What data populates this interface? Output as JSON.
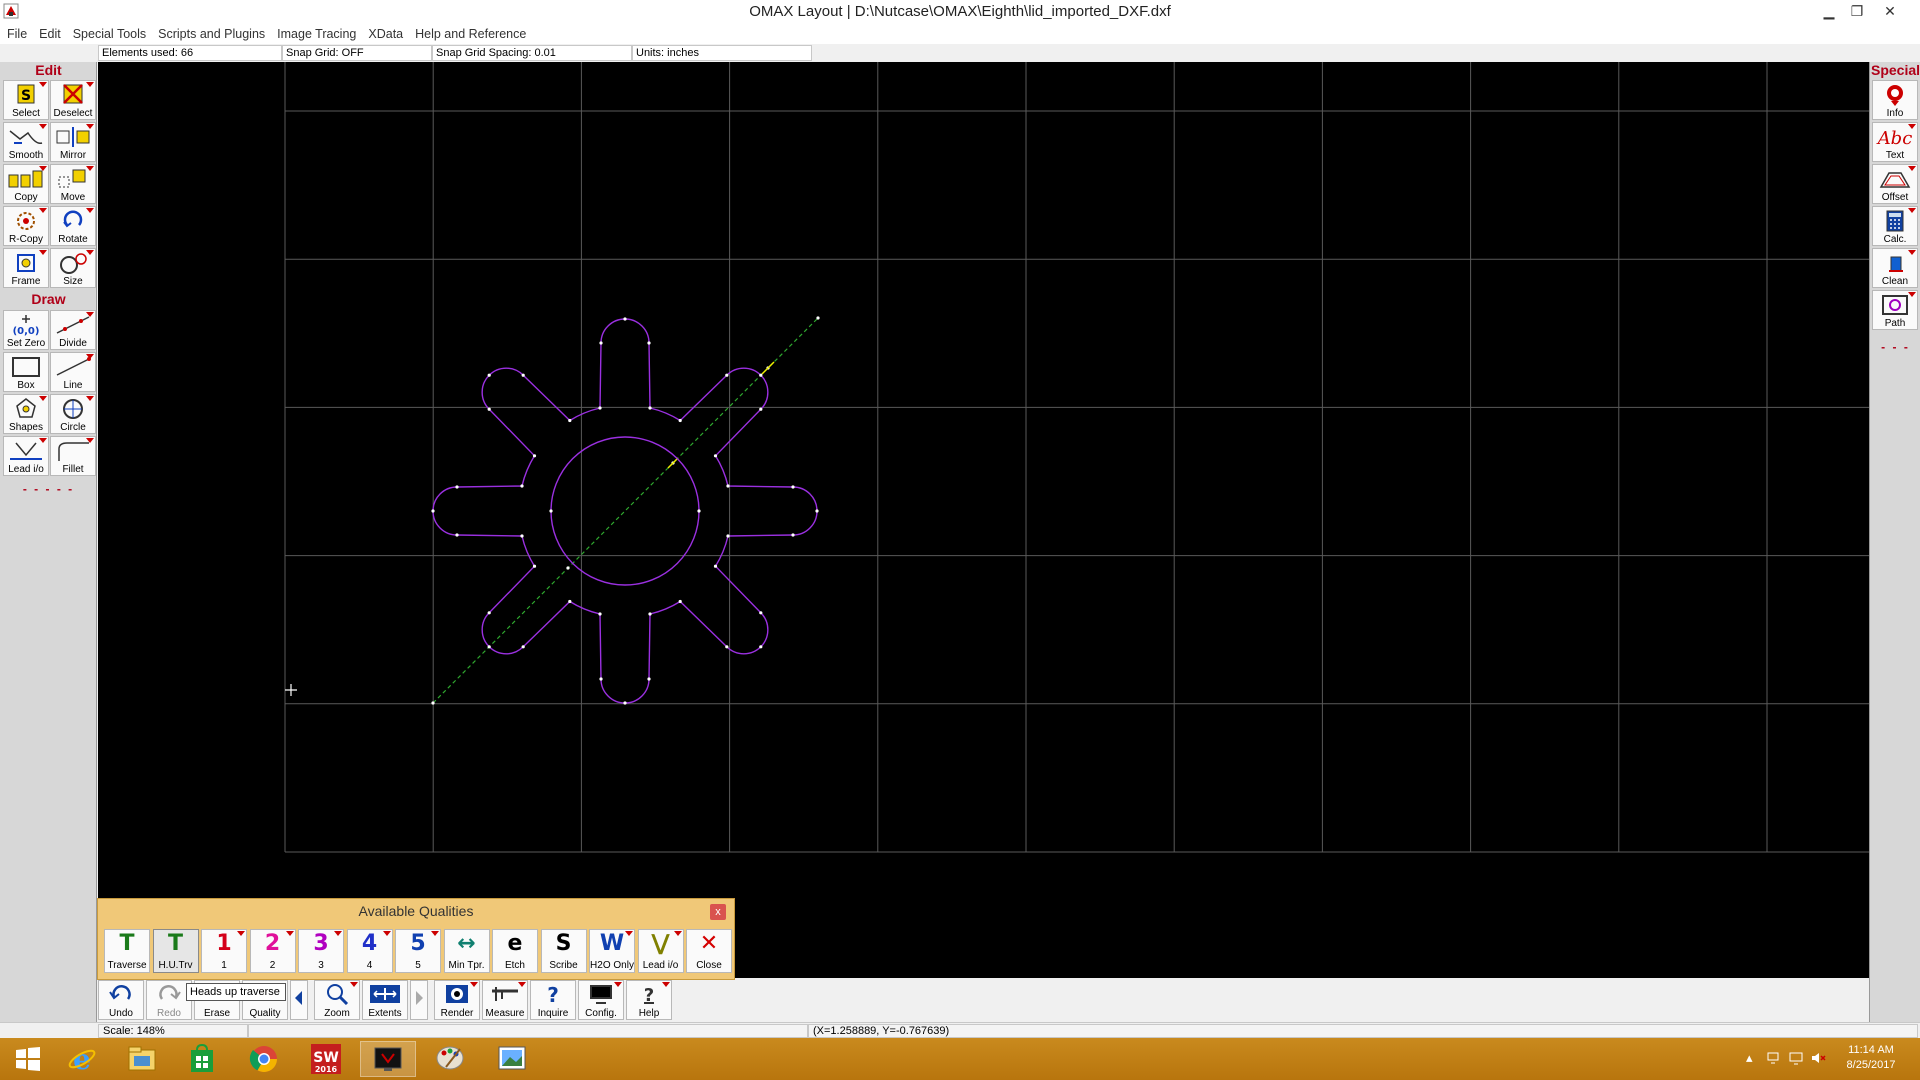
{
  "window": {
    "title": "OMAX Layout | D:\\Nutcase\\OMAX\\Eighth\\lid_imported_DXF.dxf",
    "minimize": "▁",
    "restore": "❐",
    "close": "✕"
  },
  "menu": [
    "File",
    "Edit",
    "Special Tools",
    "Scripts and Plugins",
    "Image Tracing",
    "XData",
    "Help and Reference"
  ],
  "status_fields": {
    "elements_used": "Elements used: 66",
    "snap_grid": "Snap Grid: OFF",
    "snap_spacing": "Snap Grid Spacing: 0.01",
    "units": "Units: inches"
  },
  "left_palette": {
    "edit_header": "Edit",
    "draw_header": "Draw",
    "edit_tools": [
      "Select",
      "Deselect",
      "Smooth",
      "Mirror",
      "Copy",
      "Move",
      "R-Copy",
      "Rotate",
      "Frame",
      "Size"
    ],
    "draw_tools": [
      "Set Zero",
      "Divide",
      "Box",
      "Line",
      "Shapes",
      "Circle",
      "Lead i/o",
      "Fillet"
    ],
    "dashes": "- - - - -"
  },
  "right_palette": {
    "header": "Special",
    "tools": [
      "Info",
      "Text",
      "Offset",
      "Calc.",
      "Clean",
      "Path"
    ],
    "dashes": "- - -"
  },
  "qualities_panel": {
    "title": "Available Qualities",
    "close": "x",
    "buttons": [
      {
        "glyph": "T",
        "label": "Traverse",
        "color": "#1a7a1a"
      },
      {
        "glyph": "T",
        "label": "H.U.Trv",
        "color": "#1a7a1a"
      },
      {
        "glyph": "1",
        "label": "1",
        "color": "#d4001a"
      },
      {
        "glyph": "2",
        "label": "2",
        "color": "#e0109a"
      },
      {
        "glyph": "3",
        "label": "3",
        "color": "#b000c0"
      },
      {
        "glyph": "4",
        "label": "4",
        "color": "#2030c8"
      },
      {
        "glyph": "5",
        "label": "5",
        "color": "#1040b0"
      },
      {
        "glyph": "↔",
        "label": "Min Tpr.",
        "color": "#108070"
      },
      {
        "glyph": "e",
        "label": "Etch",
        "color": "#000000"
      },
      {
        "glyph": "S",
        "label": "Scribe",
        "color": "#000000"
      },
      {
        "glyph": "W",
        "label": "H2O Only",
        "color": "#1040b0"
      },
      {
        "glyph": "⋁",
        "label": "Lead i/o",
        "color": "#808000"
      },
      {
        "glyph": "✕",
        "label": "Close",
        "color": "#d40000"
      }
    ]
  },
  "bottom_toolbar": [
    "Undo",
    "Redo",
    "Erase",
    "Quality",
    "Zoom",
    "Extents",
    "Render",
    "Measure",
    "Inquire",
    "Config.",
    "Help"
  ],
  "tooltip": "Heads up traverse",
  "statusbar": {
    "scale": "Scale: 148%",
    "coords": "(X=1.258889, Y=-0.767639)"
  },
  "taskbar": {
    "time": "11:14 AM",
    "date": "8/25/2017",
    "sw_label": "2016"
  },
  "colors": {
    "geometry": "#9a30e0",
    "traverse": "#2fa82f",
    "grid": "#5a5a5a",
    "accent": "#b00018"
  }
}
